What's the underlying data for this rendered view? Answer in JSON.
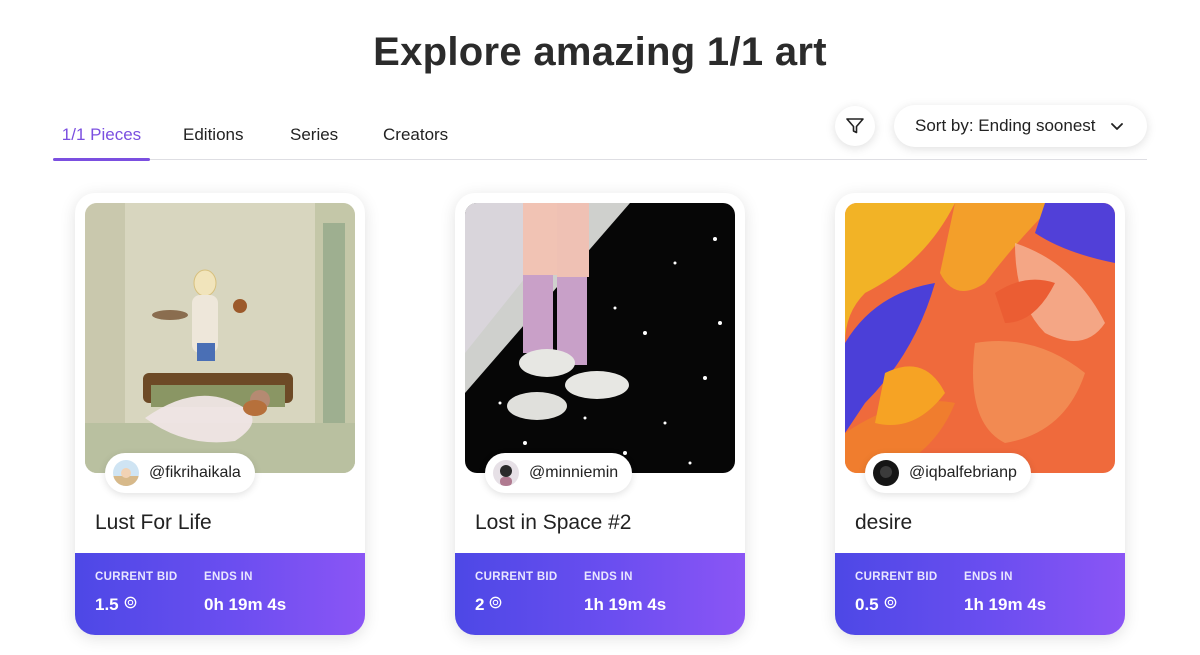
{
  "page": {
    "title": "Explore amazing 1/1 art"
  },
  "tabs": [
    {
      "label": "1/1 Pieces",
      "active": true
    },
    {
      "label": "Editions",
      "active": false
    },
    {
      "label": "Series",
      "active": false
    },
    {
      "label": "Creators",
      "active": false
    }
  ],
  "toolbar": {
    "filter_icon": "filter-icon",
    "sort_label": "Sort by: Ending soonest",
    "sort_icon": "chevron-down-icon"
  },
  "bid_labels": {
    "current_bid": "CURRENT BID",
    "ends_in": "ENDS IN"
  },
  "cards": [
    {
      "creator": "@fikrihaikala",
      "title": "Lust For Life",
      "current_bid": "1.5",
      "ends_in": "0h 19m 4s"
    },
    {
      "creator": "@minniemin",
      "title": "Lost in Space #2",
      "current_bid": "2",
      "ends_in": "1h 19m 4s"
    },
    {
      "creator": "@iqbalfebrianp",
      "title": "desire",
      "current_bid": "0.5",
      "ends_in": "1h 19m 4s"
    }
  ],
  "colors": {
    "accent": "#7b4fe0",
    "panel_start": "#4d48e6",
    "panel_end": "#8b55f5"
  }
}
